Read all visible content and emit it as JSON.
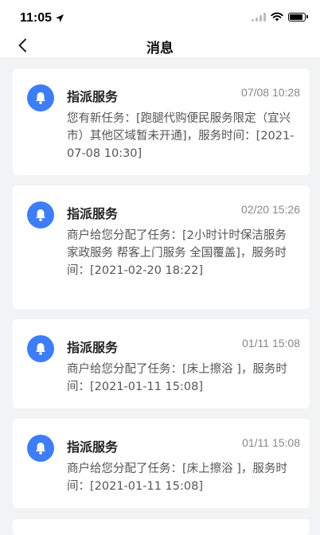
{
  "status_bar": {
    "time": "11:05"
  },
  "header": {
    "title": "消息",
    "back_icon": "chevron-left-icon"
  },
  "messages": [
    {
      "title": "指派服务",
      "time": "07/08 10:28",
      "content": "您有新任务：[跑腿代购便民服务限定（宜兴市）其他区域暂未开通]，服务时间：[2021-07-08 10:30]",
      "icon": "bell-icon"
    },
    {
      "title": "指派服务",
      "time": "02/20 15:26",
      "content": "商户给您分配了任务：[2小时计时保洁服务 家政服务 帮客上门服务 全国覆盖]，服务时间：[2021-02-20 18:22]",
      "icon": "bell-icon"
    },
    {
      "title": "指派服务",
      "time": "01/11 15:08",
      "content": "商户给您分配了任务：[床上擦浴 ]，服务时间：[2021-01-11 15:08]",
      "icon": "bell-icon"
    },
    {
      "title": "指派服务",
      "time": "01/11 15:08",
      "content": "商户给您分配了任务：[床上擦浴 ]，服务时间：[2021-01-11 15:08]",
      "icon": "bell-icon"
    }
  ],
  "colors": {
    "accent": "#3d7ef6",
    "background": "#f2f3f5",
    "card": "#ffffff"
  }
}
